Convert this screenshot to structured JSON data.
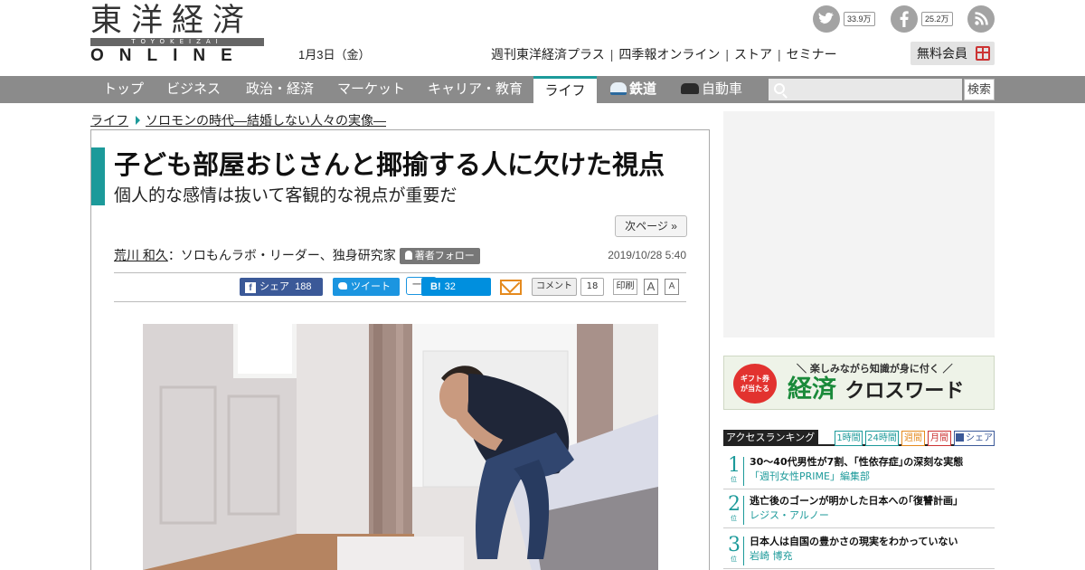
{
  "logo": {
    "kanji": "東洋経済",
    "bar_text": "TOYOKEIZAI",
    "online": "ONLINE"
  },
  "header": {
    "date": "1月3日（金）",
    "social": [
      {
        "name": "twitter",
        "count": "33.9万"
      },
      {
        "name": "facebook",
        "count": "25.2万"
      },
      {
        "name": "rss"
      }
    ],
    "service_links": [
      "週刊東洋経済プラス",
      "四季報オンライン",
      "ストア",
      "セミナー"
    ],
    "separator": "|",
    "free_member": "無料会員"
  },
  "nav": {
    "items": [
      "トップ",
      "ビジネス",
      "政治・経済",
      "マーケット",
      "キャリア・教育",
      "ライフ",
      "鉄道",
      "自動車"
    ],
    "active": "ライフ",
    "search_button": "検索"
  },
  "breadcrumb": {
    "section": "ライフ",
    "series": "ソロモンの時代―結婚しない人々の実像―"
  },
  "article": {
    "title": "子ども部屋おじさんと揶揄する人に欠けた視点",
    "subtitle": "個人的な感情は抜いて客観的な視点が重要だ",
    "next_page": "次ページ »",
    "author": "荒川 和久",
    "author_title": "：ソロもんラボ・リーダー、独身研究家",
    "follow": "著者フォロー",
    "published": "2019/10/28 5:40"
  },
  "share": {
    "facebook_label": "シェア",
    "facebook_count": "188",
    "twitter_label": "ツイート",
    "list_label": "一覧",
    "hatena_label": "B!",
    "hatena_count": "32",
    "comment_label": "コメント",
    "comment_count": "18",
    "print_label": "印刷",
    "font_large": "A",
    "font_small": "A"
  },
  "sidebar": {
    "crossword": {
      "tag_line1": "ギフト券",
      "tag_line2": "が当たる",
      "tagline": "＼ 楽しみながら知識が身に付く ／",
      "title_kanji": "経済",
      "title_kana": "クロスワード"
    },
    "ranking": {
      "title": "アクセスランキング",
      "tabs": [
        "1時間",
        "24時間",
        "週間",
        "月間",
        "シェア"
      ],
      "pos_label": "位",
      "items": [
        {
          "rank": "1",
          "headline": "30～40代男性が7割、｢性依存症｣の深刻な実態",
          "source": "「週刊女性PRIME」編集部"
        },
        {
          "rank": "2",
          "headline": "逃亡後のゴーンが明かした日本への｢復讐計画｣",
          "source": "レジス・アルノー"
        },
        {
          "rank": "3",
          "headline": "日本人は自国の豊かさの現実をわかっていない",
          "source": "岩崎 博充"
        }
      ]
    }
  },
  "colors": {
    "accent": "#1c9a9a",
    "nav_bg": "#8b8b8b",
    "facebook": "#3b5998",
    "twitter": "#1b95e0",
    "hatena": "#008fde"
  }
}
